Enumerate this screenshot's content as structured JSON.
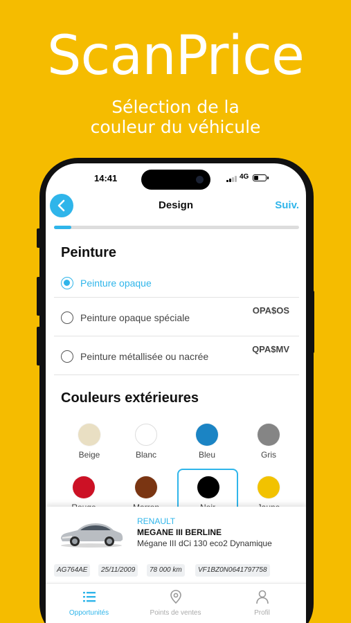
{
  "promo": {
    "title": "ScanPrice",
    "subtitle_line1": "Sélection de la",
    "subtitle_line2": "couleur du véhicule"
  },
  "status_bar": {
    "time": "14:41",
    "network": "4G"
  },
  "nav": {
    "title": "Design",
    "next_label": "Suiv.",
    "back_icon": "chevron-left-icon"
  },
  "progress": {
    "value": 0.07
  },
  "paint": {
    "title": "Peinture",
    "options": [
      {
        "label": "Peinture opaque",
        "code": "",
        "selected": true
      },
      {
        "label": "Peinture opaque spéciale",
        "code": "OPA$OS",
        "selected": false
      },
      {
        "label": "Peinture métallisée ou nacrée",
        "code": "QPA$MV",
        "selected": false
      }
    ]
  },
  "colors": {
    "title": "Couleurs extérieures",
    "items": [
      {
        "name": "Beige",
        "hex": "#E9DFC3"
      },
      {
        "name": "Blanc",
        "hex": "#FFFFFF"
      },
      {
        "name": "Bleu",
        "hex": "#1B84C4"
      },
      {
        "name": "Gris",
        "hex": "#858585"
      },
      {
        "name": "Rouge",
        "hex": "#CC1125"
      },
      {
        "name": "Marron",
        "hex": "#7A3512"
      },
      {
        "name": "Noir",
        "hex": "#000000"
      },
      {
        "name": "Jaune",
        "hex": "#F2C200"
      }
    ],
    "selected": "Noir"
  },
  "vehicle": {
    "brand": "RENAULT",
    "model": "MEGANE III BERLINE",
    "version": "Mégane III dCi 130 eco2 Dynamique",
    "plate": "AG764AE",
    "date": "25/11/2009",
    "mileage": "78 000 km",
    "vin": "VF1BZ0N0641797758"
  },
  "tabs": [
    {
      "label": "Opportunités",
      "icon": "list-icon",
      "active": true
    },
    {
      "label": "Points de ventes",
      "icon": "location-pin-icon",
      "active": false
    },
    {
      "label": "Profil",
      "icon": "user-icon",
      "active": false
    }
  ],
  "theme": {
    "accent": "#2FB5EA",
    "background": "#F5BC00"
  }
}
